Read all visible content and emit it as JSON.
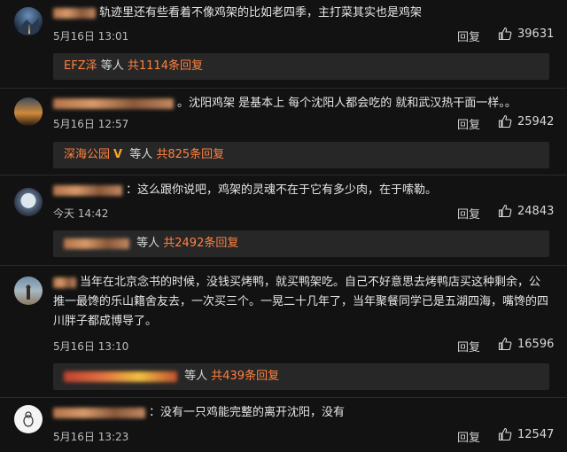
{
  "comments": [
    {
      "text": "轨迹里还有些看着不像鸡架的比如老四季，主打菜其实也是鸡架",
      "date": "5月16日 13:01",
      "reply": "回复",
      "likes": "39631",
      "replies": {
        "name": "EFZ泽",
        "middle": " 等人 ",
        "count": "共1114条回复"
      }
    },
    {
      "text": "。沈阳鸡架 是基本上 每个沈阳人都会吃的 就和武汉热干面一样。。",
      "date": "5月16日 12:57",
      "reply": "回复",
      "likes": "25942",
      "replies": {
        "name": "深海公园",
        "middle": " 等人 ",
        "count": "共825条回复"
      }
    },
    {
      "text": "：这么跟你说吧，鸡架的灵魂不在于它有多少肉，在于嗦勒。",
      "date": "今天 14:42",
      "reply": "回复",
      "likes": "24843",
      "replies": {
        "name": "",
        "middle": " 等人 ",
        "count": "共2492条回复"
      }
    },
    {
      "text": "当年在北京念书的时候，没钱买烤鸭，就买鸭架吃。自己不好意思去烤鸭店买这种剩余，公推一最馋的乐山籍舍友去，一次买三个。一晃二十几年了，当年聚餐同学已是五湖四海，嘴馋的四川胖子都成博导了。",
      "date": "5月16日 13:10",
      "reply": "回复",
      "likes": "16596",
      "replies": {
        "name": "",
        "middle": " 等人 ",
        "count": "共439条回复"
      }
    },
    {
      "text": "：没有一只鸡能完整的离开沈阳，没有",
      "date": "5月16日 13:23",
      "reply": "回复",
      "likes": "12547"
    }
  ]
}
